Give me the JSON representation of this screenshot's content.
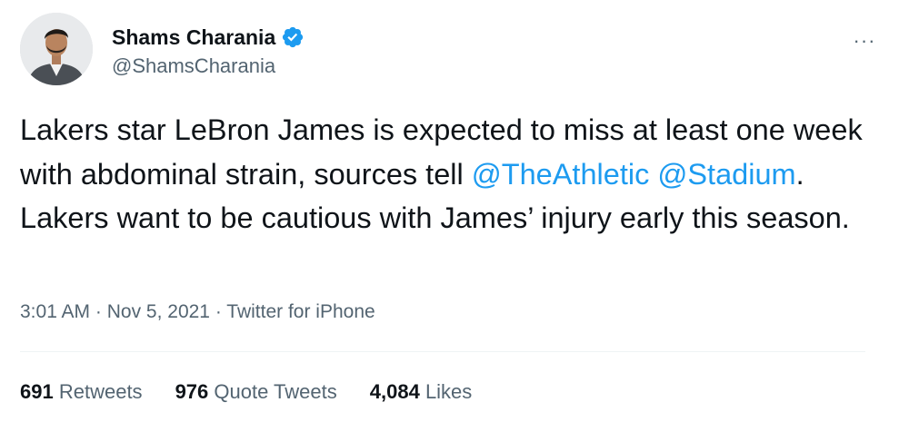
{
  "author": {
    "display_name": "Shams Charania",
    "handle": "@ShamsCharania",
    "verified": true,
    "verified_color": "#1d9bf0",
    "avatar_icon": "profile-photo"
  },
  "tweet": {
    "text_part1": "Lakers star LeBron James is expected to miss at least one week with abdominal strain, sources tell ",
    "mention1": "@TheAthletic",
    "text_space": " ",
    "mention2": "@Stadium",
    "text_part2": ". Lakers want to be cautious with James’ injury early this season.",
    "mention_color": "#1d9bf0"
  },
  "meta": {
    "time": "3:01 AM",
    "separator": " · ",
    "date": "Nov 5, 2021",
    "source": "Twitter for iPhone"
  },
  "stats": {
    "retweets_count": "691",
    "retweets_label": "Retweets",
    "quotes_count": "976",
    "quotes_label": "Quote Tweets",
    "likes_count": "4,084",
    "likes_label": "Likes"
  },
  "menu": {
    "more_icon": "more-horizontal-icon",
    "more_glyph": "···"
  }
}
